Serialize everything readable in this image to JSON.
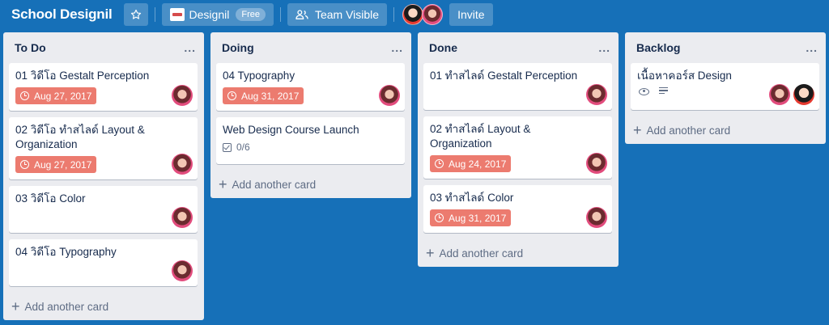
{
  "header": {
    "board_title": "School Designil",
    "team_name": "Designil",
    "team_plan": "Free",
    "visibility": "Team Visible",
    "invite_label": "Invite",
    "icons": [
      "star-icon",
      "team-logo",
      "team-visible-icon"
    ]
  },
  "colors": {
    "board_bg": "#1670b8",
    "list_bg": "#ebecf0",
    "due_badge": "#ec7b6f"
  },
  "lists": [
    {
      "title": "To Do",
      "menu": "...",
      "add_card": "Add another card",
      "cards": [
        {
          "title": "01 วิดีโอ Gestalt Perception",
          "due": "Aug 27, 2017"
        },
        {
          "title": "02 วิดีโอ ทำสไลด์ Layout & Organization",
          "due": "Aug 27, 2017"
        },
        {
          "title": "03 วิดีโอ Color"
        },
        {
          "title": "04 วิดีโอ Typography"
        }
      ]
    },
    {
      "title": "Doing",
      "menu": "...",
      "add_card": "Add another card",
      "cards": [
        {
          "title": "04 Typography",
          "due": "Aug 31, 2017"
        },
        {
          "title": "Web Design Course Launch",
          "checklist": "0/6"
        }
      ]
    },
    {
      "title": "Done",
      "menu": "...",
      "add_card": "Add another card",
      "cards": [
        {
          "title": "01 ทำสไลด์ Gestalt Perception"
        },
        {
          "title": "02 ทำสไลด์ Layout & Organization",
          "due": "Aug 24, 2017"
        },
        {
          "title": "03 ทำสไลด์ Color",
          "due": "Aug 31, 2017"
        }
      ]
    },
    {
      "title": "Backlog",
      "menu": "...",
      "add_card": "Add another card",
      "cards": [
        {
          "title": "เนื้อหาคอร์ส Design"
        }
      ]
    }
  ]
}
